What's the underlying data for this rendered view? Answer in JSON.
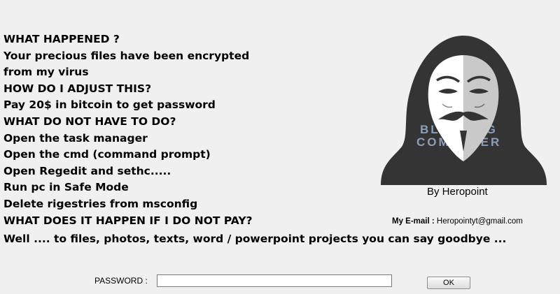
{
  "message": {
    "lines": [
      "WHAT HAPPENED ?",
      "Your precious files have been encrypted",
      "from my virus",
      "HOW DO I  ADJUST THIS?",
      "Pay 20$ in bitcoin to get password",
      "WHAT DO NOT HAVE TO DO?",
      "Open the task manager",
      "Open the cmd (command prompt)",
      "Open Regedit and sethc.....",
      "Run pc in Safe Mode",
      "Delete rigestries from msconfig",
      "WHAT DOES IT HAPPEN IF I DO NOT PAY?",
      "Well .... to files, photos, texts, word / powerpoint projects you can say goodbye ..."
    ]
  },
  "author": {
    "byline": "By Heropoint",
    "email_label": "My E-mail :",
    "email": "Heropointyt@gmail.com"
  },
  "watermark": {
    "line1": "BLEEPING",
    "line2": "COMPUTER"
  },
  "form": {
    "password_label": "PASSWORD :",
    "password_value": "",
    "ok_label": "OK"
  },
  "colors": {
    "background": "#f0f0f0",
    "hood": "#343434",
    "mask_left": "#ffffff",
    "mask_right": "#c9c9c9"
  },
  "icons": {
    "avatar": "anonymous-mask-hooded-figure"
  }
}
